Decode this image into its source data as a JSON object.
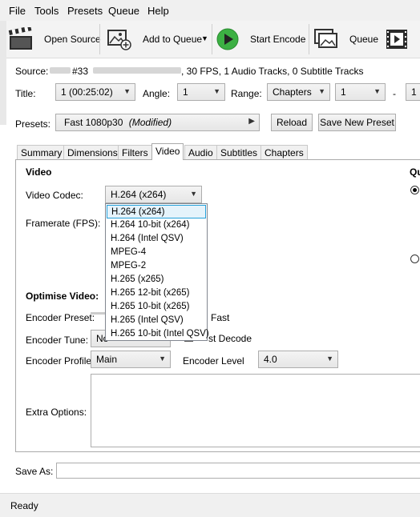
{
  "menu": {
    "file": "File",
    "tools": "Tools",
    "presets": "Presets",
    "queue": "Queue",
    "help": "Help"
  },
  "toolbar": {
    "open_source": "Open Source",
    "add_to_queue": "Add to Queue",
    "start_encode": "Start Encode",
    "queue": "Queue"
  },
  "source": {
    "label": "Source:",
    "prefix": "#33",
    "info": ", 30 FPS, 1 Audio Tracks, 0 Subtitle Tracks"
  },
  "title_row": {
    "title_label": "Title:",
    "title_value": "1 (00:25:02)",
    "angle_label": "Angle:",
    "angle_value": "1",
    "range_label": "Range:",
    "range_value": "Chapters",
    "range_start": "1",
    "dash": "-",
    "range_end": "1"
  },
  "presets": {
    "label": "Presets:",
    "value": "Fast 1080p30",
    "modified": "(Modified)",
    "reload": "Reload",
    "save_new": "Save New Preset"
  },
  "tabs": [
    "Summary",
    "Dimensions",
    "Filters",
    "Video",
    "Audio",
    "Subtitles",
    "Chapters"
  ],
  "video": {
    "section": "Video",
    "codec_label": "Video Codec:",
    "codec_value": "H.264 (x264)",
    "framerate_label": "Framerate (FPS):",
    "quality_heading": "Qu",
    "optimise_label": "Optimise Video:",
    "encoder_preset_label": "Encoder Preset:",
    "fast_label": "Fast",
    "encoder_tune_label": "Encoder Tune:",
    "tune_value": "No",
    "fast_decode_label": "st Decode",
    "encoder_profile_label": "Encoder Profile:",
    "profile_value": "Main",
    "encoder_level_label": "Encoder Level",
    "level_value": "4.0",
    "extra_options_label": "Extra Options:"
  },
  "codec_options": [
    "H.264 (x264)",
    "H.264 10-bit (x264)",
    "H.264 (Intel QSV)",
    "MPEG-4",
    "MPEG-2",
    "H.265 (x265)",
    "H.265 12-bit (x265)",
    "H.265 10-bit (x265)",
    "H.265 (Intel QSV)",
    "H.265 10-bit (Intel QSV)"
  ],
  "save_as": {
    "label": "Save As:"
  },
  "status": {
    "text": "Ready"
  },
  "colors": {
    "accent": "#26a0da",
    "play_green": "#3cb043"
  }
}
